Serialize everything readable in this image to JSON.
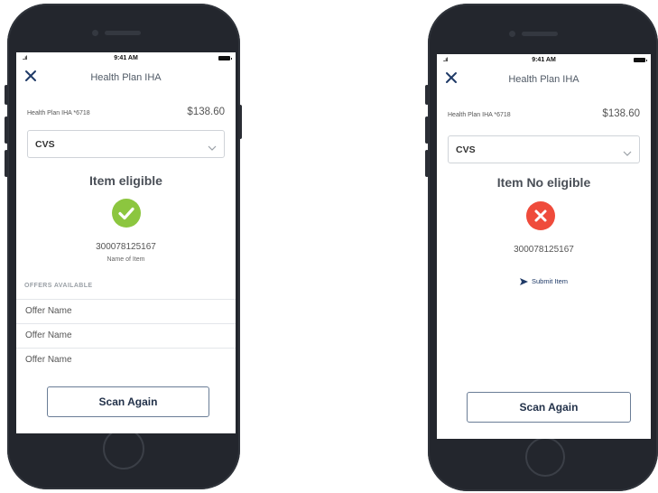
{
  "status_bar": {
    "time": "9:41 AM",
    "signal": "..ıl"
  },
  "header": {
    "title": "Health Plan IHA"
  },
  "account": {
    "label": "Health Plan IHA *6718",
    "amount": "$138.60"
  },
  "store_select": {
    "value": "CVS"
  },
  "screens": {
    "eligible": {
      "status": "Item eligible",
      "code": "300078125167",
      "item_name": "Name of Item",
      "offers_heading": "OFFERS AVAILABLE",
      "offers": [
        "Offer Name",
        "Offer Name",
        "Offer Name"
      ],
      "scan_label": "Scan Again",
      "accent": "#8cc63f"
    },
    "not_eligible": {
      "status": "Item No eligible",
      "code": "300078125167",
      "submit_label": "Submit Item",
      "scan_label": "Scan Again",
      "accent": "#ef4b3b"
    }
  },
  "icons": {
    "close": "close-icon",
    "chevron": "chevron-down-icon",
    "check": "checkmark-icon",
    "error": "x-icon",
    "send": "send-arrow-icon"
  }
}
